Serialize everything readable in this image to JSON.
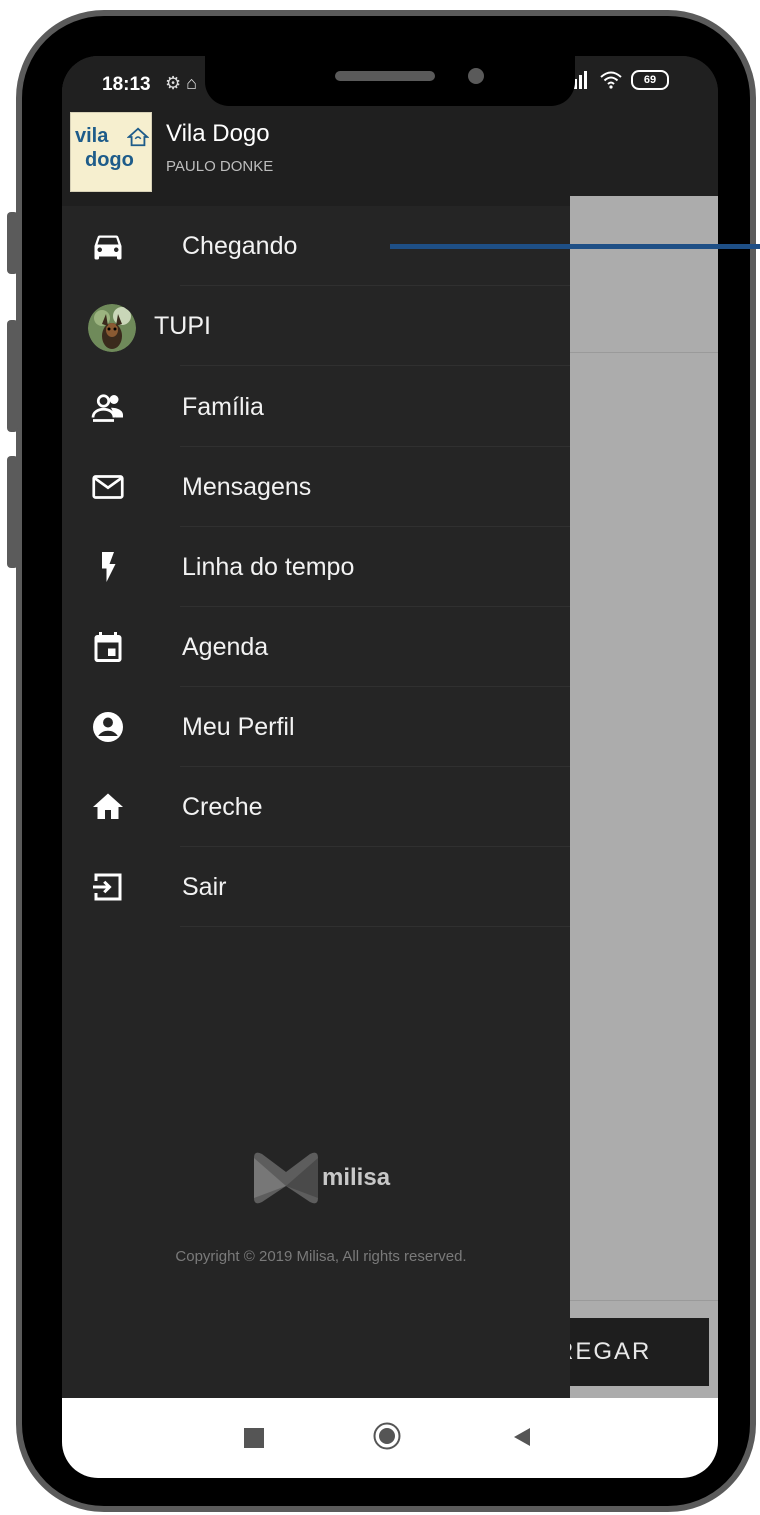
{
  "status_bar": {
    "time": "18:13",
    "left_icons": "⚙ ⌂",
    "battery": "69"
  },
  "drawer": {
    "logo": {
      "line1": "vila",
      "line2": "dogo"
    },
    "title": "Vila Dogo",
    "subtitle": "PAULO DONKE",
    "items": [
      {
        "label": "Chegando",
        "icon": "car-icon"
      },
      {
        "label": "TUPI",
        "icon": "pet-avatar"
      },
      {
        "label": "Família",
        "icon": "family-icon"
      },
      {
        "label": "Mensagens",
        "icon": "mail-icon"
      },
      {
        "label": "Linha do tempo",
        "icon": "flash-icon"
      },
      {
        "label": "Agenda",
        "icon": "calendar-icon"
      },
      {
        "label": "Meu Perfil",
        "icon": "account-circle-icon"
      },
      {
        "label": "Creche",
        "icon": "home-icon"
      },
      {
        "label": "Sair",
        "icon": "logout-icon"
      }
    ],
    "brand": "milisa",
    "copyright": "Copyright © 2019 Milisa, All rights reserved."
  },
  "app_background": {
    "action_label": "REGAR"
  },
  "colors": {
    "drawer_bg": "#252525",
    "scrim": "#acacac",
    "annotation": "#1e4f86",
    "logo_text": "#1e5c8a"
  }
}
